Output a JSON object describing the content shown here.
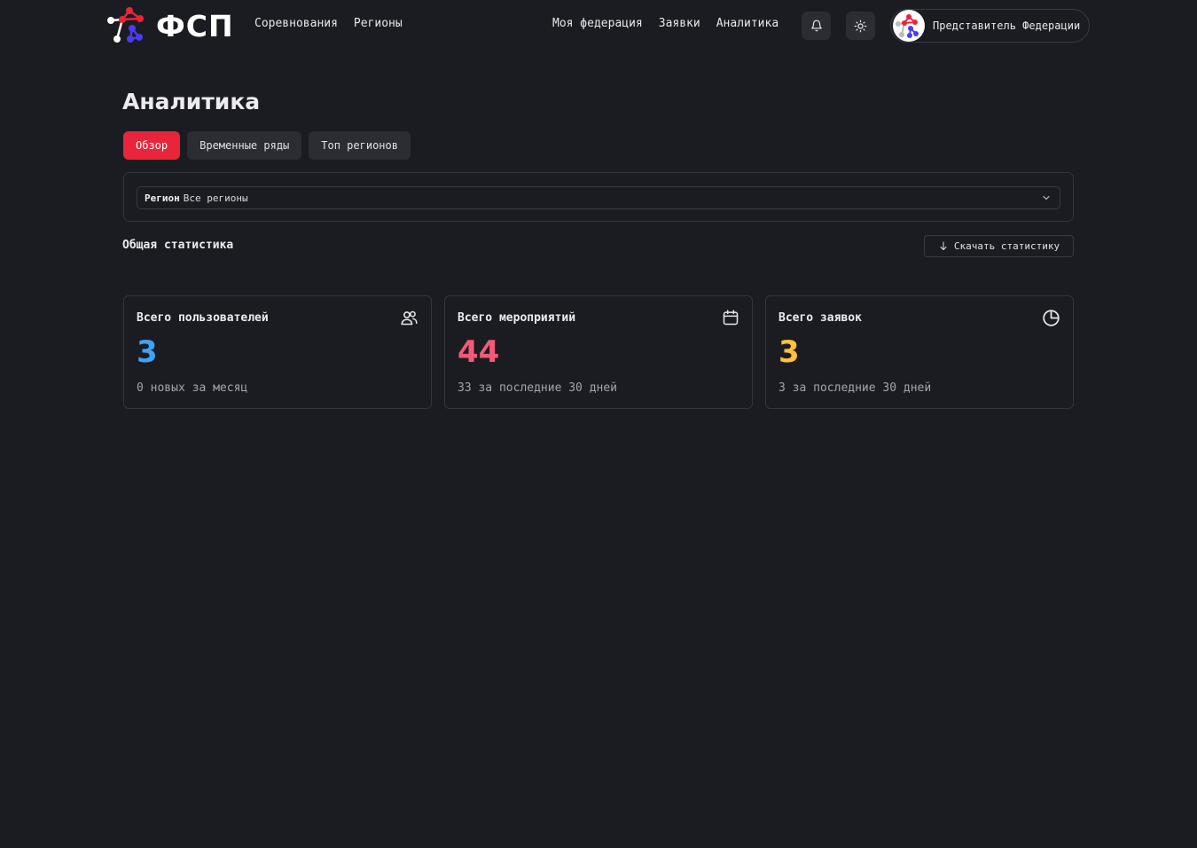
{
  "header": {
    "logo_text": "ФСП",
    "nav_left": [
      "Соревнования",
      "Регионы"
    ],
    "nav_right": [
      "Моя федерация",
      "Заявки",
      "Аналитика"
    ],
    "user_name": "Представитель Федерации"
  },
  "page": {
    "title": "Аналитика",
    "tabs": [
      {
        "label": "Обзор",
        "active": true
      },
      {
        "label": "Временные ряды",
        "active": false
      },
      {
        "label": "Топ регионов",
        "active": false
      }
    ]
  },
  "filter": {
    "label": "Регион",
    "value": "Все регионы"
  },
  "stats": {
    "section_title": "Общая статистика",
    "download_label": "Скачать статистику",
    "cards": [
      {
        "title": "Всего пользователей",
        "value": "3",
        "subtitle": "0 новых за месяц",
        "color": "#3ea2f5",
        "icon": "users-icon"
      },
      {
        "title": "Всего мероприятий",
        "value": "44",
        "subtitle": "33 за последние 30 дней",
        "color": "#f25a78",
        "icon": "calendar-icon"
      },
      {
        "title": "Всего заявок",
        "value": "3",
        "subtitle": "3 за последние 30 дней",
        "color": "#ffc13a",
        "icon": "pie-chart-icon"
      }
    ]
  },
  "colors": {
    "background": "#1b1c21",
    "accent": "#e8253a"
  }
}
